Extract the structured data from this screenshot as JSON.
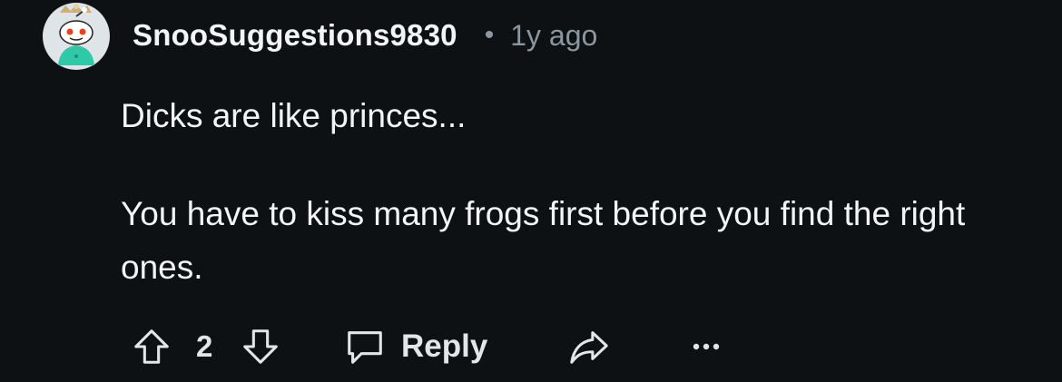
{
  "comment": {
    "author": "SnooSuggestions9830",
    "separator": "•",
    "timestamp": "1y ago",
    "paragraphs": [
      "Dicks are like princes...",
      "You have to kiss many frogs first before you find the right ones."
    ]
  },
  "actions": {
    "vote_count": "2",
    "reply_label": "Reply"
  },
  "icons": {
    "upvote": "arrow-up-outline-icon",
    "downvote": "arrow-down-outline-icon",
    "reply": "speech-bubble-icon",
    "share": "share-arrow-icon",
    "more": "ellipsis-icon"
  },
  "colors": {
    "background": "#0e1113",
    "text": "#f2f4f5",
    "muted": "#8b97a0",
    "avatar_shirt": "#2ec9a7"
  }
}
